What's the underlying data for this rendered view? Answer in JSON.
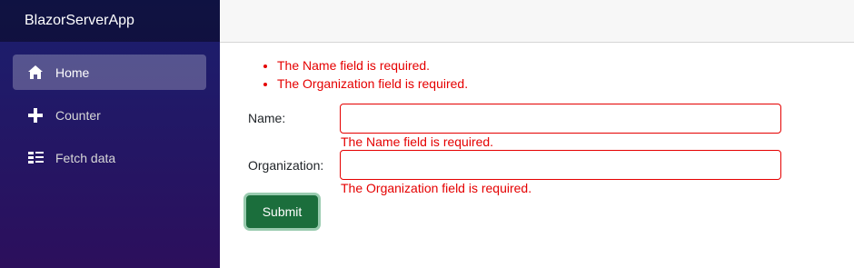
{
  "app": {
    "brand": "BlazorServerApp"
  },
  "nav": {
    "items": [
      {
        "label": "Home",
        "icon": "home-icon",
        "active": true
      },
      {
        "label": "Counter",
        "icon": "plus-icon",
        "active": false
      },
      {
        "label": "Fetch data",
        "icon": "list-icon",
        "active": false
      }
    ]
  },
  "form": {
    "summary": [
      "The Name field is required.",
      "The Organization field is required."
    ],
    "name": {
      "label": "Name:",
      "value": "",
      "error": "The Name field is required."
    },
    "organization": {
      "label": "Organization:",
      "value": "",
      "error": "The Organization field is required."
    },
    "submit_label": "Submit"
  },
  "colors": {
    "error": "#e50000",
    "submit": "#1b6e3c",
    "sidebar_top": "#1a1f6e",
    "sidebar_bottom": "#2c0f5c"
  }
}
